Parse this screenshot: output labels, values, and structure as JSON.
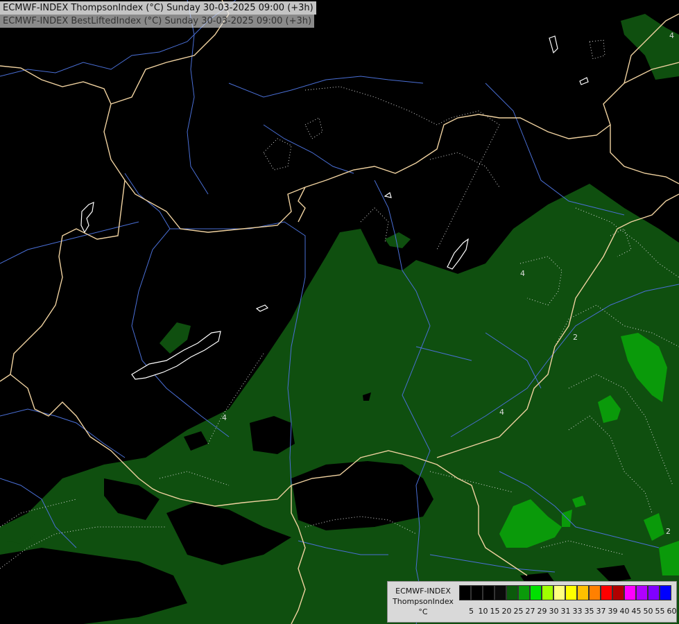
{
  "titles": {
    "line1": "ECMWF-INDEX ThompsonIndex (°C) Sunday 30-03-2025 09:00 (+3h)",
    "line2": "ECMWF-INDEX BestLiftedIndex (°C) Sunday 30-03-2025 09:00 (+3h)"
  },
  "legend": {
    "line1": "ECMWF-INDEX",
    "line2": "ThompsonIndex",
    "line3": "°C",
    "ticks": [
      "5",
      "10",
      "15",
      "20",
      "25",
      "27",
      "29",
      "30",
      "31",
      "33",
      "35",
      "37",
      "39",
      "40",
      "45",
      "50",
      "55",
      "60"
    ],
    "colors": [
      "#000000",
      "#000000",
      "#000000",
      "#0a0a0a",
      "#0b5a0b",
      "#0a9a0a",
      "#00e000",
      "#a0ff00",
      "#ffff80",
      "#ffff00",
      "#ffc000",
      "#ff8000",
      "#ff0000",
      "#b00000",
      "#ff00ff",
      "#b000ff",
      "#8000ff",
      "#0000ff"
    ]
  },
  "contour_labels": [
    "4",
    "2",
    "4",
    "2",
    "4",
    "4"
  ],
  "colors": {
    "background": "#000000",
    "green_dark": "#0f4f0f",
    "green_mid": "#0a7a0a",
    "green_bright": "#12b812",
    "border": "#f0d2a0",
    "river": "#4a6fd6"
  }
}
